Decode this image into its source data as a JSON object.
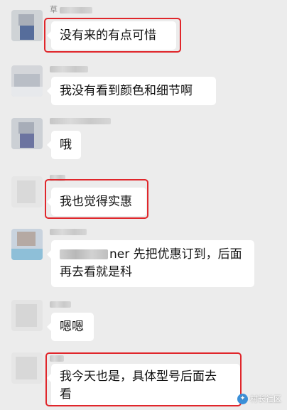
{
  "messages": [
    {
      "sender_label": "草",
      "text": "没有来的有点可惜"
    },
    {
      "text": "我没有看到颜色和细节啊"
    },
    {
      "text": "哦"
    },
    {
      "text": "我也觉得实惠"
    },
    {
      "text_suffix": "ner 先把优惠订到，后面",
      "text_line2": "再去看就是科"
    },
    {
      "text": "嗯嗯"
    },
    {
      "text": "我今天也是，具体型号后面去",
      "text_line2": "看"
    }
  ],
  "watermark": {
    "text": "村长社区",
    "icon": "chat-logo-icon"
  },
  "colors": {
    "background": "#ececec",
    "bubble": "#ffffff",
    "highlight": "#e0262b"
  }
}
